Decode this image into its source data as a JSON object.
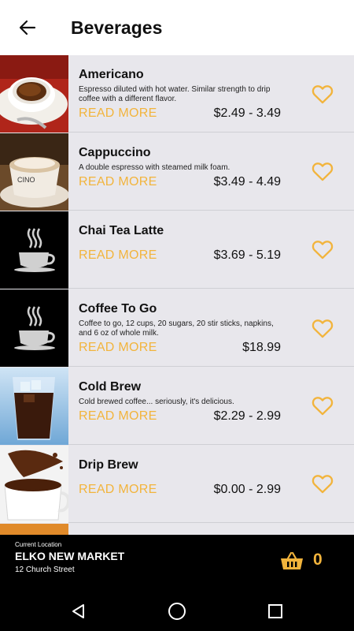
{
  "header": {
    "title": "Beverages"
  },
  "items": [
    {
      "name": "Americano",
      "description": "Espresso diluted with hot water. Similar strength to drip coffee with a different flavor.",
      "read_more": "READ MORE",
      "price": "$2.49 - 3.49"
    },
    {
      "name": "Cappuccino",
      "description": "A double espresso with steamed milk foam.",
      "read_more": "READ MORE",
      "price": "$3.49 - 4.49"
    },
    {
      "name": "Chai Tea Latte",
      "description": "",
      "read_more": "READ MORE",
      "price": "$3.69 - 5.19"
    },
    {
      "name": "Coffee To Go",
      "description": "Coffee to go, 12 cups, 20 sugars, 20 stir sticks, napkins, and  6 oz of whole milk.",
      "read_more": "READ MORE",
      "price": "$18.99"
    },
    {
      "name": "Cold Brew",
      "description": "Cold brewed coffee... seriously, it's delicious.",
      "read_more": "READ MORE",
      "price": "$2.29 - 2.99"
    },
    {
      "name": "Drip Brew",
      "description": "",
      "read_more": "READ MORE",
      "price": "$0.00 - 2.99"
    }
  ],
  "location": {
    "label": "Current Location",
    "name": "ELKO NEW MARKET",
    "address": "12 Church Street"
  },
  "cart": {
    "count": "0",
    "icon": "basket-icon"
  },
  "colors": {
    "accent": "#f2b43c",
    "row_bg": "#e8e7ec",
    "bar_bg": "#000000"
  }
}
